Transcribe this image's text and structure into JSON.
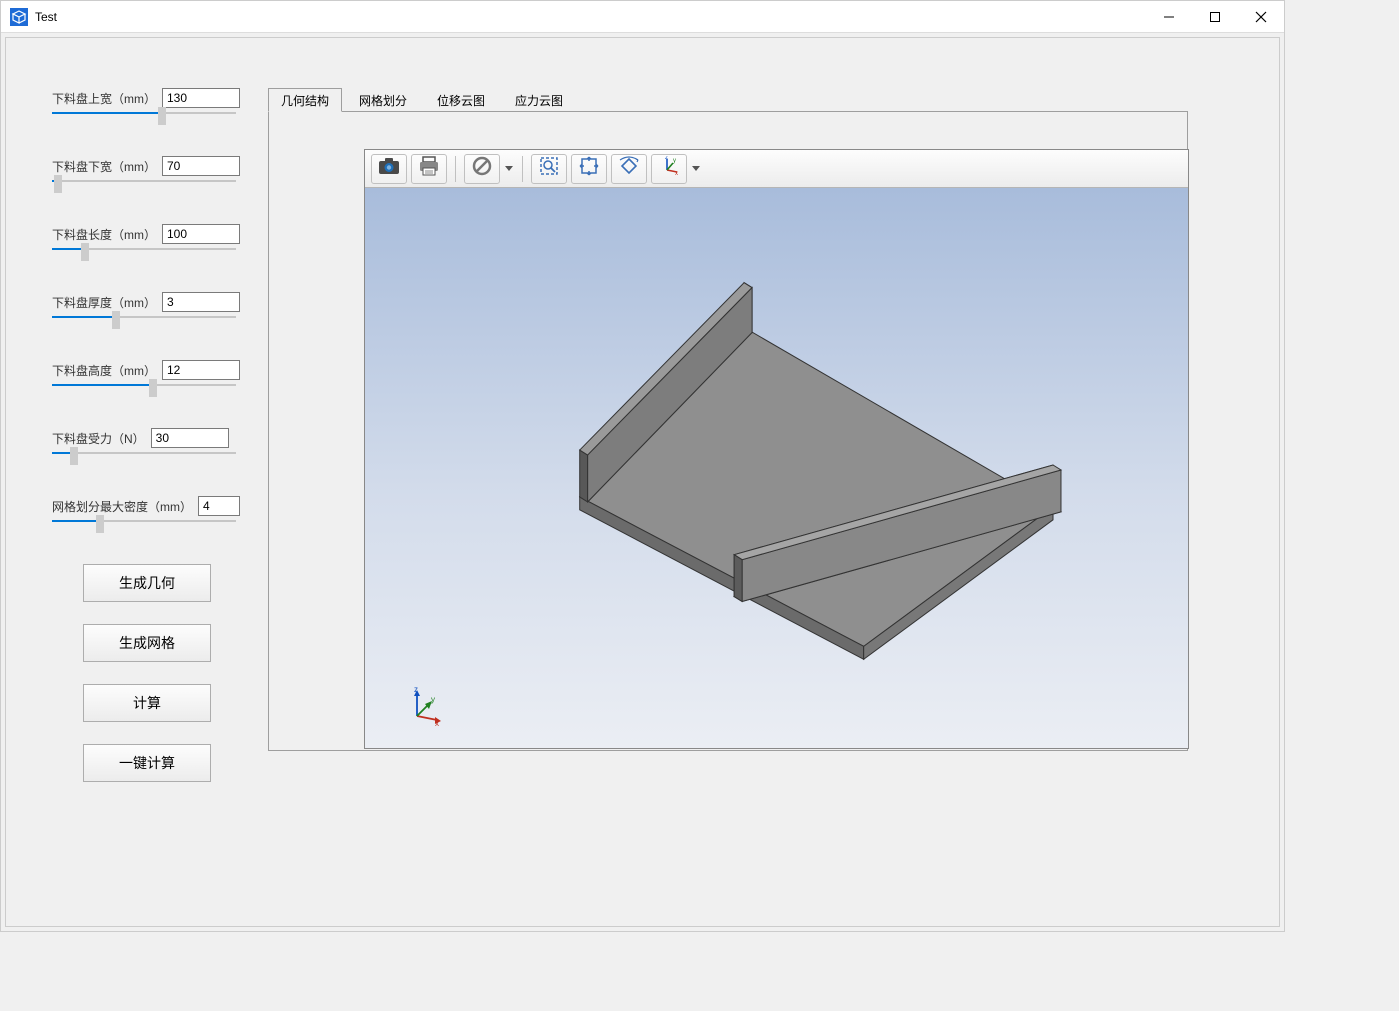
{
  "window": {
    "title": "Test"
  },
  "params": [
    {
      "label": "下料盘上宽（mm）",
      "value": "130",
      "pct": 60
    },
    {
      "label": "下料盘下宽（mm）",
      "value": "70",
      "pct": 3
    },
    {
      "label": "下料盘长度（mm）",
      "value": "100",
      "pct": 18
    },
    {
      "label": "下料盘厚度（mm）",
      "value": "3",
      "pct": 35
    },
    {
      "label": "下料盘高度（mm）",
      "value": "12",
      "pct": 55
    },
    {
      "label": "下料盘受力（N）",
      "value": "30",
      "pct": 12
    },
    {
      "label": "网格划分最大密度（mm）",
      "value": "4",
      "pct": 26,
      "narrow": true
    }
  ],
  "buttons": {
    "gen_geometry": "生成几何",
    "gen_mesh": "生成网格",
    "calculate": "计算",
    "one_click": "一键计算"
  },
  "tabs": [
    {
      "label": "几何结构",
      "active": true
    },
    {
      "label": "网格划分",
      "active": false
    },
    {
      "label": "位移云图",
      "active": false
    },
    {
      "label": "应力云图",
      "active": false
    }
  ],
  "viewer_toolbar": {
    "camera": "camera-icon",
    "print": "print-icon",
    "forbid": "no-symbol-icon",
    "zoom_box": "zoom-box-icon",
    "fit": "fit-view-icon",
    "rotate": "rotate-icon",
    "axis": "axis-icon"
  },
  "axis_labels": {
    "x": "x",
    "y": "y",
    "z": "z"
  }
}
